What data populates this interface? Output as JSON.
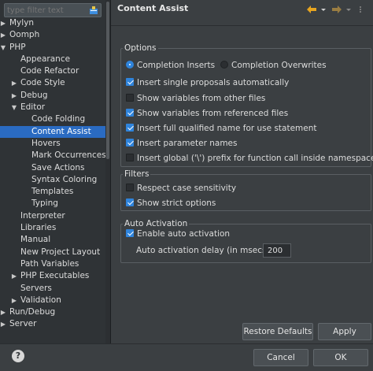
{
  "filter": {
    "placeholder": "type filter text"
  },
  "tree": [
    {
      "label": "Mylyn",
      "depth": 0,
      "expander": "collapsed",
      "selected": false
    },
    {
      "label": "Oomph",
      "depth": 0,
      "expander": "collapsed",
      "selected": false
    },
    {
      "label": "PHP",
      "depth": 0,
      "expander": "expanded",
      "selected": false
    },
    {
      "label": "Appearance",
      "depth": 1,
      "expander": "none",
      "selected": false
    },
    {
      "label": "Code Refactor",
      "depth": 1,
      "expander": "none",
      "selected": false
    },
    {
      "label": "Code Style",
      "depth": 1,
      "expander": "collapsed",
      "selected": false
    },
    {
      "label": "Debug",
      "depth": 1,
      "expander": "collapsed",
      "selected": false
    },
    {
      "label": "Editor",
      "depth": 1,
      "expander": "expanded",
      "selected": false
    },
    {
      "label": "Code Folding",
      "depth": 2,
      "expander": "none",
      "selected": false
    },
    {
      "label": "Content Assist",
      "depth": 2,
      "expander": "none",
      "selected": true
    },
    {
      "label": "Hovers",
      "depth": 2,
      "expander": "none",
      "selected": false
    },
    {
      "label": "Mark Occurrences",
      "depth": 2,
      "expander": "none",
      "selected": false
    },
    {
      "label": "Save Actions",
      "depth": 2,
      "expander": "none",
      "selected": false
    },
    {
      "label": "Syntax Coloring",
      "depth": 2,
      "expander": "none",
      "selected": false
    },
    {
      "label": "Templates",
      "depth": 2,
      "expander": "none",
      "selected": false
    },
    {
      "label": "Typing",
      "depth": 2,
      "expander": "none",
      "selected": false
    },
    {
      "label": "Interpreter",
      "depth": 1,
      "expander": "none",
      "selected": false
    },
    {
      "label": "Libraries",
      "depth": 1,
      "expander": "none",
      "selected": false
    },
    {
      "label": "Manual",
      "depth": 1,
      "expander": "none",
      "selected": false
    },
    {
      "label": "New Project Layout",
      "depth": 1,
      "expander": "none",
      "selected": false
    },
    {
      "label": "Path Variables",
      "depth": 1,
      "expander": "none",
      "selected": false
    },
    {
      "label": "PHP Executables",
      "depth": 1,
      "expander": "collapsed",
      "selected": false
    },
    {
      "label": "Servers",
      "depth": 1,
      "expander": "none",
      "selected": false
    },
    {
      "label": "Validation",
      "depth": 1,
      "expander": "collapsed",
      "selected": false
    },
    {
      "label": "Run/Debug",
      "depth": 0,
      "expander": "collapsed",
      "selected": false
    },
    {
      "label": "Server",
      "depth": 0,
      "expander": "collapsed",
      "selected": false
    }
  ],
  "page": {
    "title": "Content Assist",
    "options": {
      "title": "Options",
      "insert_mode": [
        {
          "label": "Completion Inserts",
          "selected": true
        },
        {
          "label": "Completion Overwrites",
          "selected": false
        }
      ],
      "checks": [
        {
          "label": "Insert single proposals automatically",
          "checked": true
        },
        {
          "label": "Show variables from other files",
          "checked": false
        },
        {
          "label": "Show variables from referenced files",
          "checked": true
        },
        {
          "label": "Insert full qualified name for use statement",
          "checked": true
        },
        {
          "label": "Insert parameter names",
          "checked": true
        },
        {
          "label": "Insert global ('\\') prefix for function call inside namespace",
          "checked": false
        }
      ]
    },
    "filters": {
      "title": "Filters",
      "checks": [
        {
          "label": "Respect case sensitivity",
          "checked": false
        },
        {
          "label": "Show strict options",
          "checked": true
        }
      ]
    },
    "auto_activation": {
      "title": "Auto Activation",
      "enable_label": "Enable auto activation",
      "enable_checked": true,
      "delay_label": "Auto activation delay (in msecs)",
      "delay_value": "200"
    },
    "buttons": {
      "restore": "Restore Defaults",
      "apply": "Apply"
    }
  },
  "dialog": {
    "cancel": "Cancel",
    "ok": "OK"
  },
  "icons": {
    "back": "back-arrow-icon",
    "forward": "forward-arrow-icon",
    "help": "help-icon",
    "filter": "filter-clear-icon"
  },
  "colors": {
    "accent": "#2f84dc",
    "selection": "#2a6bc2",
    "nav_arrow": "#e7a520"
  }
}
